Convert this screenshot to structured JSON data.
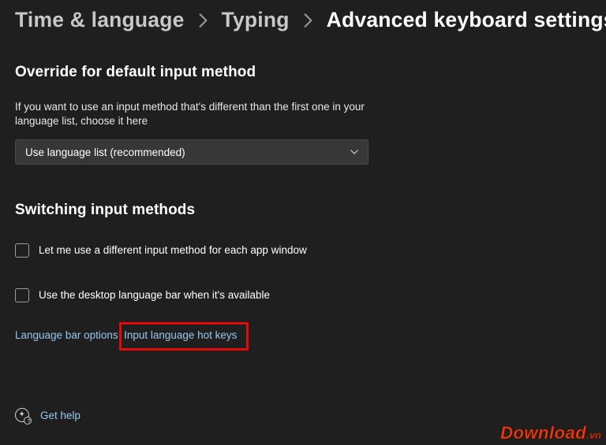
{
  "breadcrumb": {
    "level1": "Time & language",
    "level2": "Typing",
    "current": "Advanced keyboard settings"
  },
  "override": {
    "title": "Override for default input method",
    "desc": "If you want to use an input method that's different than the first one in your language list, choose it here",
    "dropdown_value": "Use language list (recommended)"
  },
  "switching": {
    "title": "Switching input methods",
    "opt_per_window": "Let me use a different input method for each app window",
    "opt_desktop_bar": "Use the desktop language bar when it's available"
  },
  "links": {
    "language_bar_options": "Language bar options",
    "input_hotkeys": "Input language hot keys",
    "get_help": "Get help"
  },
  "watermark": {
    "main": "Download",
    "suffix": ".vn"
  }
}
